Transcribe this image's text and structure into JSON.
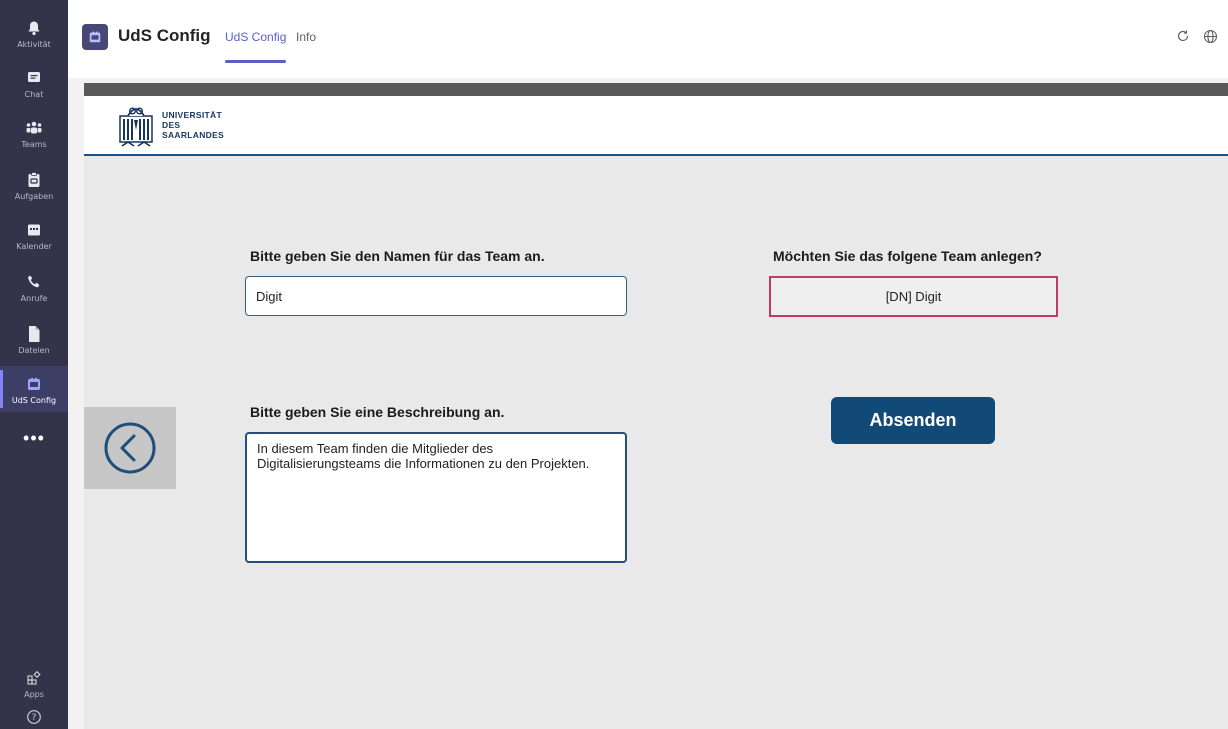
{
  "rail": {
    "items": [
      {
        "label": "Aktivität",
        "icon": "bell-icon"
      },
      {
        "label": "Chat",
        "icon": "chat-icon"
      },
      {
        "label": "Teams",
        "icon": "teams-icon"
      },
      {
        "label": "Aufgaben",
        "icon": "tasks-icon"
      },
      {
        "label": "Kalender",
        "icon": "calendar-icon"
      },
      {
        "label": "Anrufe",
        "icon": "phone-icon"
      },
      {
        "label": "Dateien",
        "icon": "file-icon"
      },
      {
        "label": "UdS Config",
        "icon": "app-icon",
        "active": true
      }
    ],
    "more": "•••",
    "apps_label": "Apps",
    "help_icon": "help-icon"
  },
  "header": {
    "app_title": "UdS Config",
    "tabs": [
      {
        "label": "UdS Config",
        "active": true
      },
      {
        "label": "Info",
        "active": false
      }
    ],
    "refresh_icon": "refresh-icon",
    "globe_icon": "globe-icon"
  },
  "brand": {
    "line1": "UNIVERSITÄT",
    "line2": "DES",
    "line3": "SAARLANDES"
  },
  "form": {
    "name_label": "Bitte geben Sie den Namen für das Team an.",
    "name_value": "Digit",
    "description_label": "Bitte geben Sie eine Beschreibung an.",
    "description_value": "In diesem Team finden die Mitglieder des Digitalisierungsteams die Informationen zu den Projekten.",
    "confirm_label": "Möchten Sie das folgene Team anlegen?",
    "preview_value": "[DN] Digit",
    "submit_label": "Absenden"
  },
  "colors": {
    "rail": "#33344a",
    "accent": "#5b5fc7",
    "submit": "#124a77",
    "preview_border": "#c23a6a",
    "brand_blue": "#1d4f8f"
  }
}
